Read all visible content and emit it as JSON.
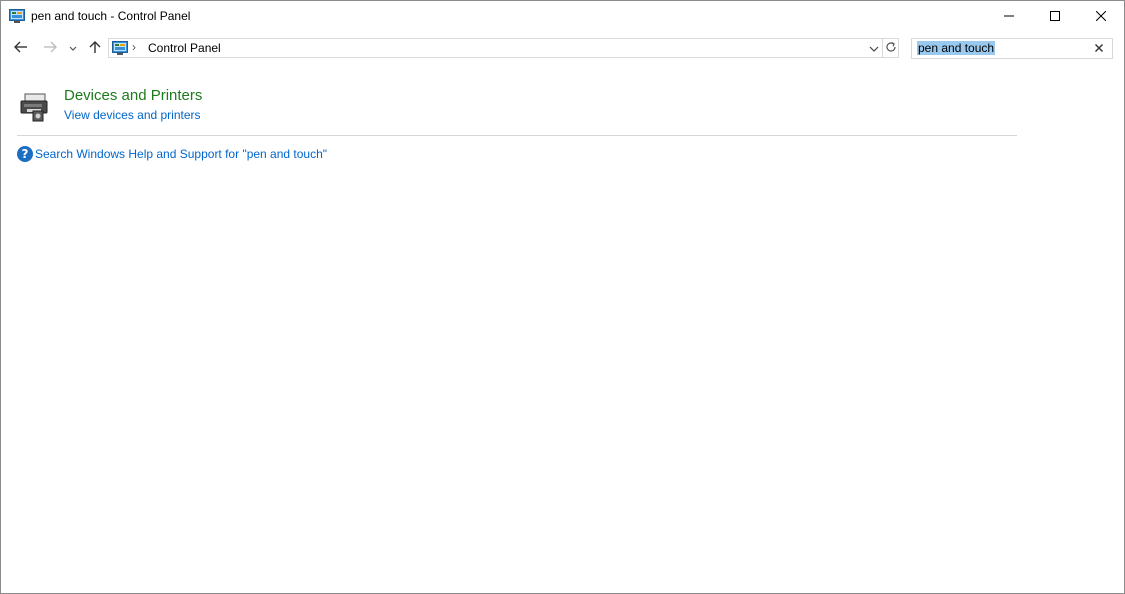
{
  "window": {
    "title": "pen and touch - Control Panel"
  },
  "titlebar": {
    "icon": "control-panel-icon",
    "minimize_icon": "minimize-icon",
    "maximize_icon": "maximize-icon",
    "close_icon": "close-icon"
  },
  "navigation": {
    "back_icon": "arrow-left-icon",
    "forward_icon": "arrow-right-icon",
    "recent_icon": "chevron-down-icon",
    "up_icon": "arrow-up-icon"
  },
  "address_bar": {
    "icon": "control-panel-icon",
    "separator": "›",
    "breadcrumb": "Control Panel",
    "dropdown_icon": "chevron-down-icon",
    "refresh_icon": "refresh-icon"
  },
  "search": {
    "value": "pen and touch",
    "clear_icon": "close-icon"
  },
  "results": [
    {
      "icon": "devices-and-printers-icon",
      "title": "Devices and Printers",
      "subtitle": "View devices and printers"
    }
  ],
  "help": {
    "icon": "help-icon",
    "glyph": "?",
    "link_text": "Search Windows Help and Support for \"pen and touch\""
  },
  "colors": {
    "result_title": "#1e7a1e",
    "link": "#0066cc",
    "search_highlight": "#99c9ef",
    "help_icon_bg": "#1a6fc4"
  }
}
